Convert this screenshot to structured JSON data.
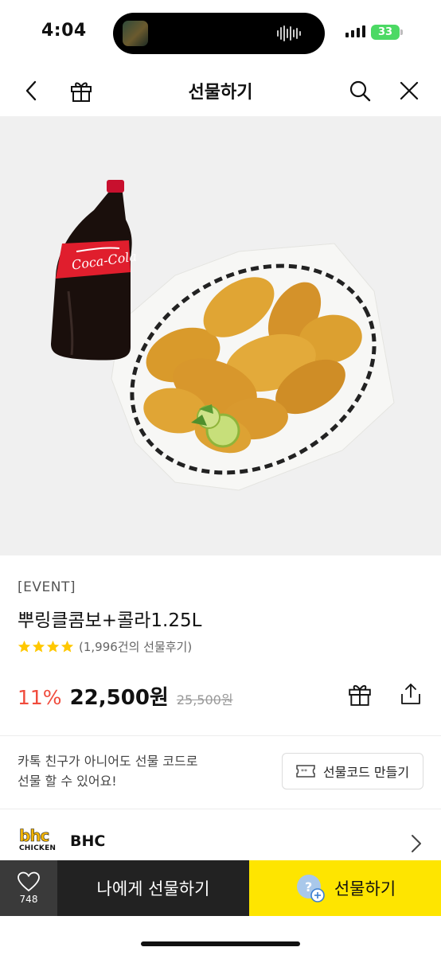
{
  "status_bar": {
    "time": "4:04",
    "battery": "33"
  },
  "nav": {
    "title": "선물하기",
    "icons": [
      "back-icon",
      "gift-icon",
      "search-icon",
      "close-icon"
    ]
  },
  "product": {
    "event_tag": "[EVENT]",
    "name": "뿌링클콤보+콜라1.25L",
    "rating_stars": 4,
    "review_count": "(1,996건의 선물후기)",
    "discount": "11%",
    "price": "22,500원",
    "original_price": "25,500원",
    "image_labels": {
      "bottle_brand": "Coca-Cola"
    }
  },
  "gift_code": {
    "description_line1": "카톡 친구가 아니어도 선물 코드로",
    "description_line2": "선물 할 수 있어요!",
    "button_label": "선물코드 만들기"
  },
  "brand": {
    "logo_top": "bhc",
    "logo_bottom": "CHICKEN",
    "name": "BHC"
  },
  "bottom_bar": {
    "like_count": "748",
    "self_gift_label": "나에게 선물하기",
    "gift_label": "선물하기"
  },
  "colors": {
    "accent_yellow": "#fee500",
    "discount_red": "#f04b3c",
    "star_yellow": "#ffc800",
    "dark_button": "#222222",
    "image_bg": "#f0f0f0"
  }
}
